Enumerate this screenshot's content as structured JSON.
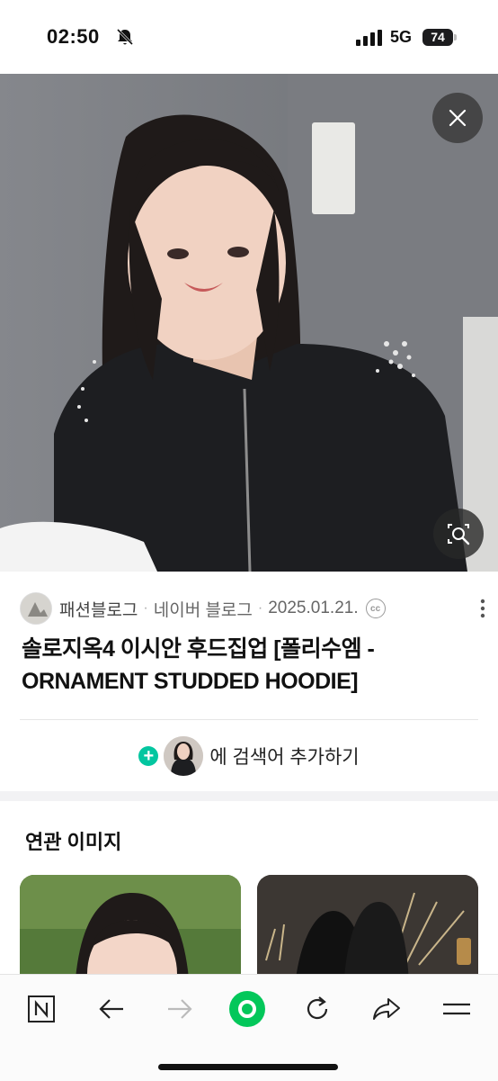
{
  "status_bar": {
    "time": "02:50",
    "network": "5G",
    "battery": "74"
  },
  "result": {
    "source_name": "패션블로그",
    "source_site": "네이버 블로그",
    "date": "2025.01.21.",
    "license_badge": "cc",
    "title": "솔로지옥4 이시안 후드집업 [폴리수엠 - ORNAMENT STUDDED HOODIE]"
  },
  "add_search": {
    "label": "에 검색어 추가하기",
    "plus": "+"
  },
  "related": {
    "title": "연관 이미지"
  },
  "icons": {
    "close": "close-icon",
    "lens": "image-search-icon",
    "more": "more-vertical-icon",
    "home": "naver-home-icon",
    "back": "back-arrow-icon",
    "forward": "forward-arrow-icon",
    "green": "green-dot-icon",
    "reload": "reload-icon",
    "share": "share-icon",
    "menu": "menu-icon"
  },
  "colors": {
    "accent": "#03c75a",
    "plus": "#03c6a0"
  }
}
